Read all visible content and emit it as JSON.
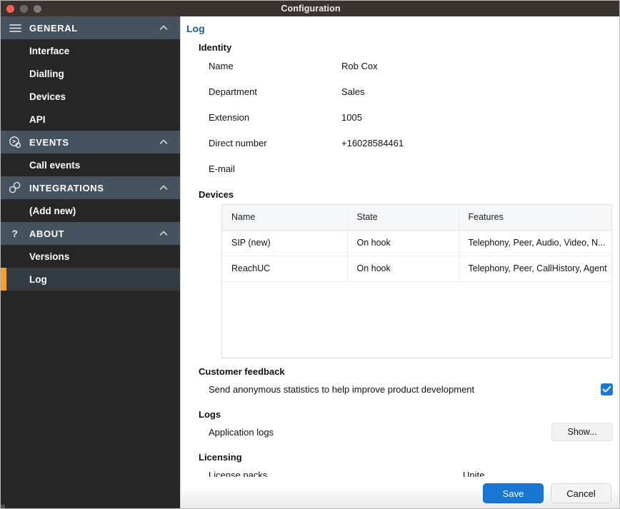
{
  "window": {
    "title": "Configuration",
    "controls": [
      "close-button",
      "minimize-button",
      "maximize-button"
    ]
  },
  "sidebar": {
    "sections": [
      {
        "icon": "hamburger-icon",
        "label": "GENERAL",
        "expanded": true,
        "items": [
          {
            "label": "Interface",
            "selected": false
          },
          {
            "label": "Dialling",
            "selected": false
          },
          {
            "label": "Devices",
            "selected": false
          },
          {
            "label": "API",
            "selected": false
          }
        ]
      },
      {
        "icon": "call-event-icon",
        "label": "EVENTS",
        "expanded": true,
        "items": [
          {
            "label": "Call events",
            "selected": false
          }
        ]
      },
      {
        "icon": "link-icon",
        "label": "INTEGRATIONS",
        "expanded": true,
        "items": [
          {
            "label": "(Add new)",
            "selected": false
          }
        ]
      },
      {
        "icon": "question-mark-icon",
        "label": "ABOUT",
        "expanded": true,
        "items": [
          {
            "label": "Versions",
            "selected": false
          },
          {
            "label": "Log",
            "selected": true
          }
        ]
      }
    ],
    "accent_color": "#f3a12c",
    "header_color": "#46525e",
    "item_color": "#262626"
  },
  "content": {
    "page_title": "Log",
    "identity": {
      "title": "Identity",
      "rows": [
        {
          "key": "Name",
          "value": "Rob Cox"
        },
        {
          "key": "Department",
          "value": "Sales"
        },
        {
          "key": "Extension",
          "value": "1005"
        },
        {
          "key": "Direct number",
          "value": "+16028584461"
        },
        {
          "key": "E-mail",
          "value": ""
        }
      ]
    },
    "devices": {
      "title": "Devices",
      "columns": [
        "Name",
        "State",
        "Features"
      ],
      "rows": [
        [
          "SIP (new)",
          "On hook",
          "Telephony, Peer, Audio, Video, N..."
        ],
        [
          "ReachUC",
          "On hook",
          "Telephony, Peer, CallHistory, Agent"
        ]
      ]
    },
    "customer_feedback": {
      "title": "Customer feedback",
      "option_label": "Send anonymous statistics to help improve product development",
      "checked": true
    },
    "logs": {
      "title": "Logs",
      "row_label": "Application logs",
      "button_label": "Show..."
    },
    "licensing": {
      "title": "Licensing",
      "row_label": "License packs",
      "value": "Unite"
    }
  },
  "footer": {
    "save_label": "Save",
    "cancel_label": "Cancel",
    "primary_color": "#1876d2"
  }
}
